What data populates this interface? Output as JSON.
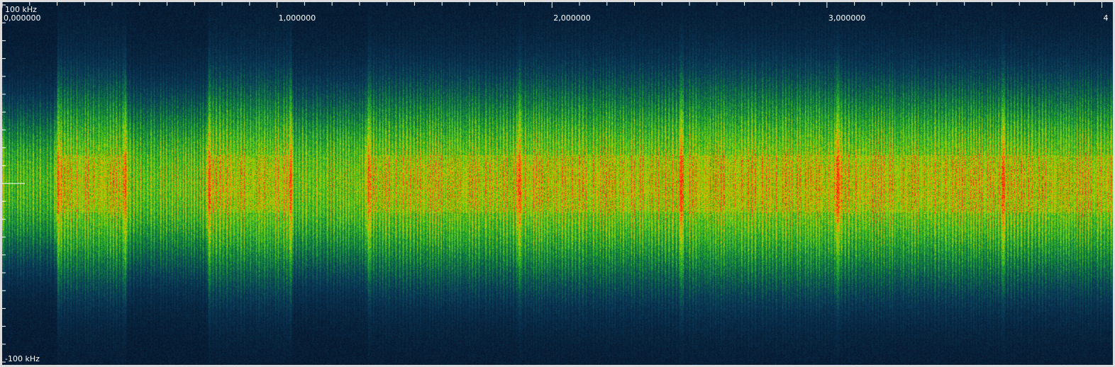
{
  "chart_data": {
    "type": "heatmap",
    "title": "",
    "y_axis": {
      "top_label": "100 kHz",
      "bottom_label": "-100 kHz",
      "range_khz": [
        -100,
        100
      ]
    },
    "x_axis": {
      "ticks": [
        {
          "value": 0,
          "label": "0,000000"
        },
        {
          "value": 1,
          "label": "1,000000"
        },
        {
          "value": 2,
          "label": "2,000000"
        },
        {
          "value": 3,
          "label": "3,000000"
        },
        {
          "value": 4,
          "label": "4"
        }
      ],
      "range": [
        0,
        4.04
      ]
    },
    "colormap": [
      "#061226",
      "#0a3a5a",
      "#108040",
      "#3cc020",
      "#b0d000",
      "#f0a000",
      "#ff2000"
    ],
    "center_marker_khz": 0,
    "grid": false,
    "burst_segments": [
      {
        "start": 0.0,
        "end": 0.2,
        "level": 0.45
      },
      {
        "start": 0.2,
        "end": 0.45,
        "level": 0.7
      },
      {
        "start": 0.45,
        "end": 0.75,
        "level": 0.55
      },
      {
        "start": 0.75,
        "end": 1.05,
        "level": 0.72
      },
      {
        "start": 1.05,
        "end": 1.33,
        "level": 0.58
      },
      {
        "start": 1.33,
        "end": 1.88,
        "level": 0.68
      },
      {
        "start": 1.88,
        "end": 2.47,
        "level": 0.72
      },
      {
        "start": 2.47,
        "end": 3.04,
        "level": 0.75
      },
      {
        "start": 3.04,
        "end": 3.64,
        "level": 0.72
      },
      {
        "start": 3.64,
        "end": 4.04,
        "level": 0.7
      }
    ]
  }
}
